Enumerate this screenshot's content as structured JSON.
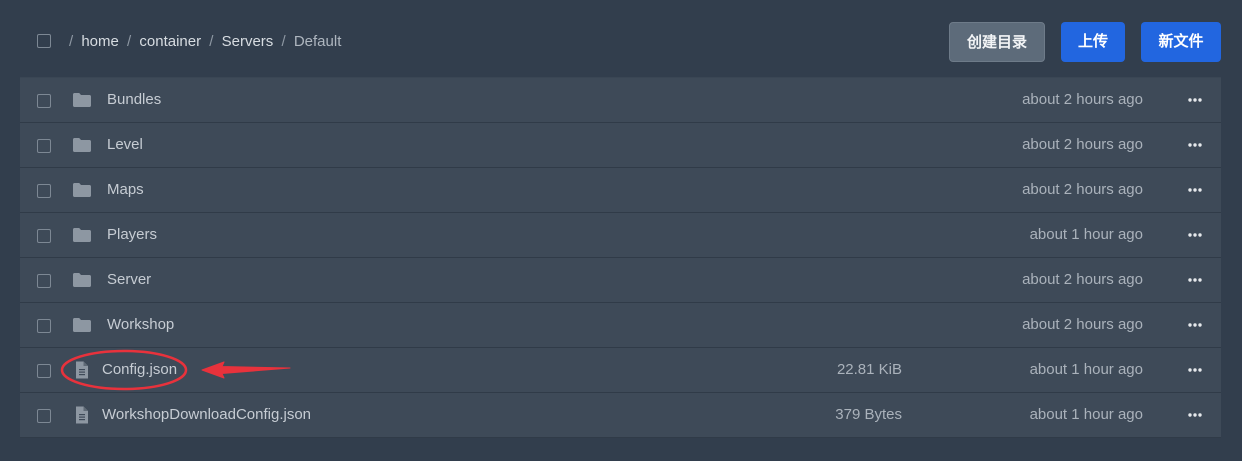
{
  "toolbar": {
    "breadcrumb": [
      {
        "label": "home"
      },
      {
        "label": "container"
      },
      {
        "label": "Servers"
      },
      {
        "label": "Default"
      }
    ],
    "create_dir_label": "创建目录",
    "upload_label": "上传",
    "new_file_label": "新文件"
  },
  "files": [
    {
      "name": "Bundles",
      "type": "folder",
      "size": "",
      "modified": "about 2 hours ago"
    },
    {
      "name": "Level",
      "type": "folder",
      "size": "",
      "modified": "about 2 hours ago"
    },
    {
      "name": "Maps",
      "type": "folder",
      "size": "",
      "modified": "about 2 hours ago"
    },
    {
      "name": "Players",
      "type": "folder",
      "size": "",
      "modified": "about 1 hour ago"
    },
    {
      "name": "Server",
      "type": "folder",
      "size": "",
      "modified": "about 2 hours ago"
    },
    {
      "name": "Workshop",
      "type": "folder",
      "size": "",
      "modified": "about 2 hours ago"
    },
    {
      "name": "Config.json",
      "type": "file",
      "size": "22.81 KiB",
      "modified": "about 1 hour ago"
    },
    {
      "name": "WorkshopDownloadConfig.json",
      "type": "file",
      "size": "379 Bytes",
      "modified": "about 1 hour ago"
    }
  ],
  "icons": {
    "folder": "folder-icon",
    "file": "file-text-icon",
    "more": "more-horizontal-icon"
  },
  "colors": {
    "background": "#323e4d",
    "row": "#3e4a58",
    "primary": "#2266e0",
    "secondary": "#5d6b7a",
    "annotation": "#e8323c"
  }
}
